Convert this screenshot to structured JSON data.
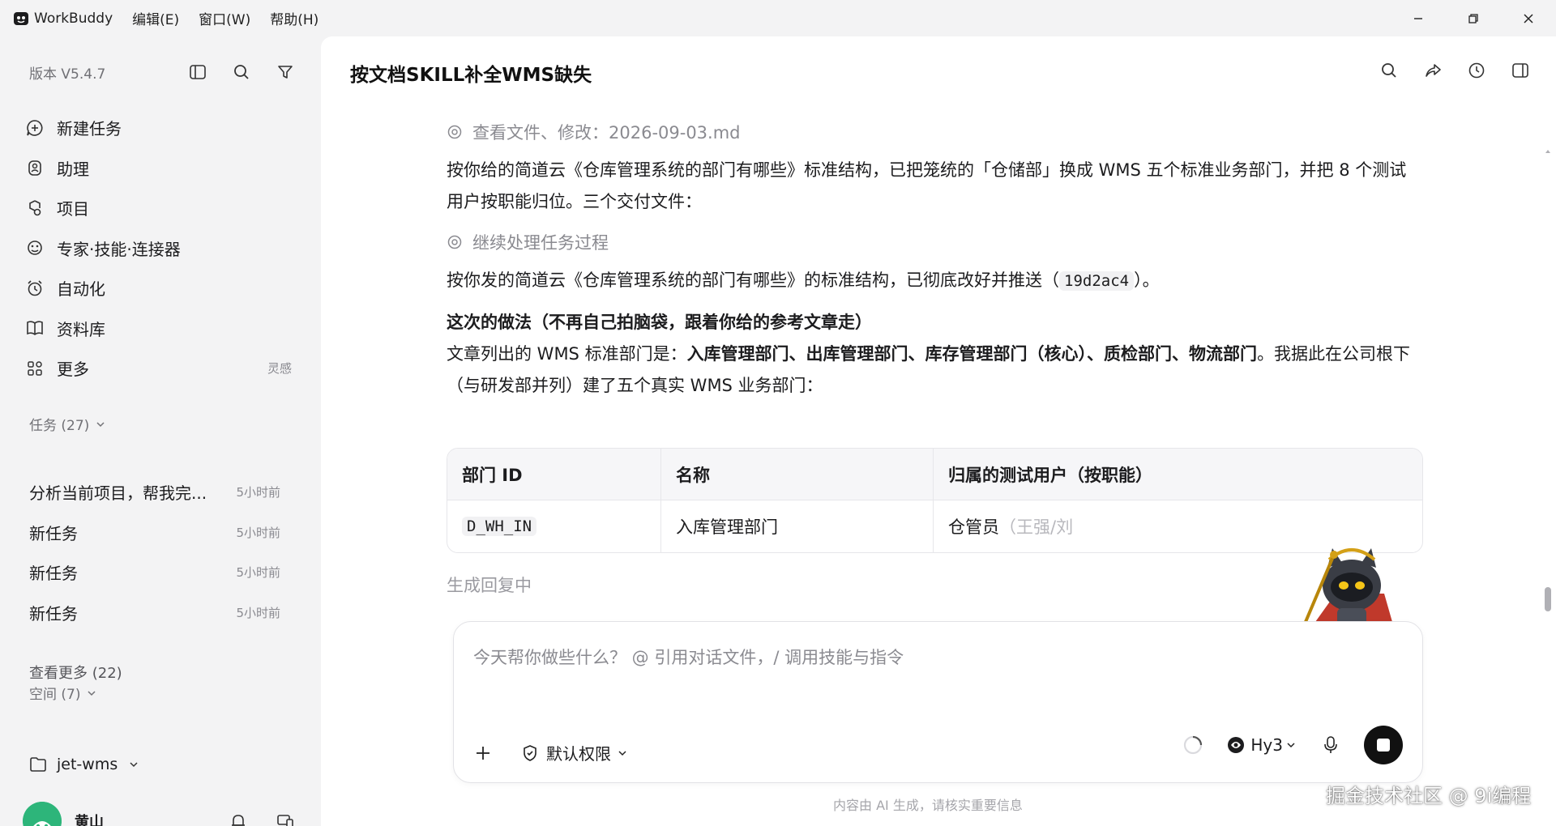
{
  "app": {
    "name": "WorkBuddy",
    "menu": [
      "编辑(E)",
      "窗口(W)",
      "帮助(H)"
    ],
    "brand_color": "#111111"
  },
  "sidebar": {
    "version": "版本 V5.4.7",
    "nav": [
      {
        "label": "新建任务",
        "icon": "plus-bubble-icon"
      },
      {
        "label": "助理",
        "icon": "assistant-icon"
      },
      {
        "label": "项目",
        "icon": "project-icon"
      },
      {
        "label": "专家·技能·连接器",
        "icon": "expert-icon"
      },
      {
        "label": "自动化",
        "icon": "alarm-icon"
      },
      {
        "label": "资料库",
        "icon": "book-icon"
      },
      {
        "label": "更多",
        "icon": "grid-icon",
        "aux": "灵感"
      }
    ],
    "tasks_header": "任务 (27)",
    "tasks": [
      {
        "title": "分析当前项目，帮我完...",
        "time": "5小时前"
      },
      {
        "title": "新任务",
        "time": "5小时前"
      },
      {
        "title": "新任务",
        "time": "5小时前"
      },
      {
        "title": "新任务",
        "time": "5小时前"
      }
    ],
    "see_more": "查看更多 (22)",
    "spaces_header": "空间 (7)",
    "space": "jet-wms",
    "user": "黄山"
  },
  "main": {
    "title": "按文档SKILL补全WMS缺失",
    "step1": "查看文件、修改：2026-09-03.md",
    "para1": "按你给的简道云《仓库管理系统的部门有哪些》标准结构，已把笼统的「仓储部」换成 WMS 五个标准业务部门，并把 8 个测试用户按职能归位。三个交付文件：",
    "step2": "继续处理任务过程",
    "para2_a": "按你发的简道云《仓库管理系统的部门有哪些》的标准结构，已彻底改好并推送（",
    "para2_code": "19d2ac4",
    "para2_b": "）。",
    "approach_title": "这次的做法（不再自己拍脑袋，跟着你给的参考文章走）",
    "approach_a": "文章列出的 WMS 标准部门是：",
    "approach_bold": "入库管理部门、出库管理部门、库存管理部门（核心）、质检部门、物流部门",
    "approach_b": "。我据此在公司根下（与研发部并列）建了五个真实 WMS 业务部门：",
    "table": {
      "headers": [
        "部门 ID",
        "名称",
        "归属的测试用户（按职能）"
      ],
      "row": {
        "id": "D_WH_IN",
        "name": "入库管理部门",
        "users_a": "仓管员",
        "users_b": "（王强/刘"
      }
    },
    "generating": "生成回复中",
    "composer": {
      "placeholder": "今天帮你做些什么？ @ 引用对话文件，/ 调用技能与指令",
      "permission": "默认权限",
      "model": "Hy3"
    },
    "disclaimer": "内容由 AI 生成，请核实重要信息",
    "watermark": "掘金技术社区 @ 9i编程"
  }
}
